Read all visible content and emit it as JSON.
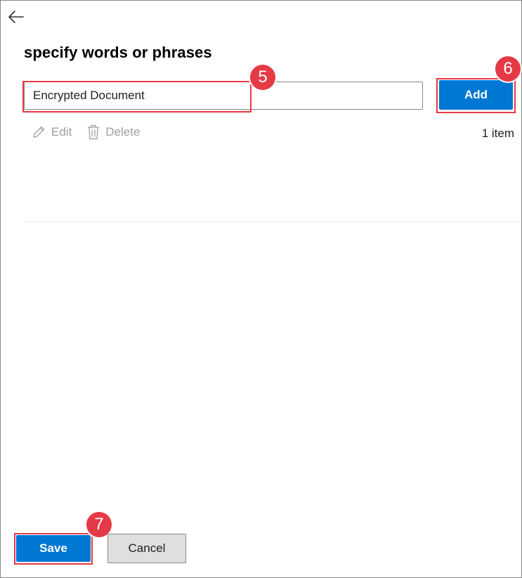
{
  "header": {
    "back_icon": "arrow-left-icon",
    "title": "specify words or phrases"
  },
  "form": {
    "input_value": "Encrypted Document",
    "add_label": "Add"
  },
  "toolbar": {
    "edit_label": "Edit",
    "edit_icon": "pencil-icon",
    "delete_label": "Delete",
    "delete_icon": "trash-icon",
    "item_count": "1 item"
  },
  "footer": {
    "save_label": "Save",
    "cancel_label": "Cancel"
  },
  "annotations": {
    "step_input": "5",
    "step_add": "6",
    "step_save": "7",
    "color": "#e63946"
  },
  "colors": {
    "primary": "#0078d4",
    "disabled_text": "#a19f9d",
    "border": "#8a8886"
  }
}
